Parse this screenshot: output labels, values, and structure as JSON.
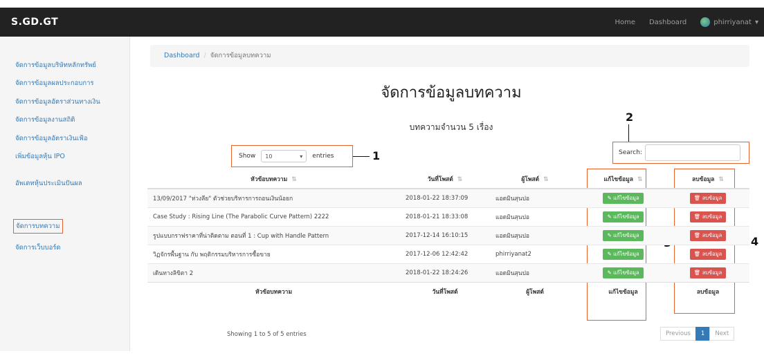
{
  "navbar": {
    "brand": "S.GD.GT",
    "home": "Home",
    "dashboard": "Dashboard",
    "user": "phirriyanat"
  },
  "sidebar": {
    "items": [
      {
        "label": "จัดการข้อมูลบริษัทหลักทรัพย์"
      },
      {
        "label": "จัดการข้อมูลผลประกอบการ"
      },
      {
        "label": "จัดการข้อมูลอัตราส่วนทางเงิน"
      },
      {
        "label": "จัดการข้อมูลงานสถิติ"
      },
      {
        "label": "จัดการข้อมูลอัตราเงินเฟ้อ"
      },
      {
        "label": "เพิ่มข้อมูลหุ้น IPO"
      },
      {
        "label": "อัพเดทหุ้นประเมินปันผล"
      },
      {
        "label": "จัดการบทความ"
      },
      {
        "label": "จัดการเว็บบอร์ด"
      }
    ]
  },
  "breadcrumb": {
    "home": "Dashboard",
    "current": "จัดการข้อมูลบทความ"
  },
  "page_title": "จัดการข้อมูลบทความ",
  "count_text": "บทความจำนวน 5 เรื่อง",
  "table_length": {
    "show": "Show",
    "value": "10",
    "entries": "entries"
  },
  "search": {
    "label": "Search:",
    "value": ""
  },
  "callouts": [
    "1",
    "2",
    "3",
    "4"
  ],
  "table": {
    "headers": [
      "หัวข้อบทความ",
      "วันที่โพสต์",
      "ผู้โพสต์",
      "แก้ไขข้อมูล",
      "ลบข้อมูล"
    ],
    "edit_label": "แก้ไขข้อมูล",
    "delete_label": "ลบข้อมูล",
    "rows": [
      {
        "title": "13/09/2017 \"ห่วงลีย\" ตัวช่วยบริหารการถอนเงินน้อยก",
        "date": "2018-01-22 18:37:09",
        "author": "แอดมินสุนปอ"
      },
      {
        "title": "Case Study : Rising Line (The Parabolic Curve Pattern) 2222",
        "date": "2018-01-21 18:33:08",
        "author": "แอดมินสุนปอ"
      },
      {
        "title": "รูปแบบกราฟราคาที่น่าติดตาม ตอนที่ 1 : Cup with Handle Pattern",
        "date": "2017-12-14 16:10:15",
        "author": "แอดมินสุนปอ"
      },
      {
        "title": "วิฏจักรพื้นฐาน กับ พฤติกรรมบริหารการซื้อขาย",
        "date": "2017-12-06 12:42:42",
        "author": "phirriyanat2"
      },
      {
        "title": "เดินทางลิขิตา 2",
        "date": "2018-01-22 18:24:26",
        "author": "แอดมินสุนปอ"
      }
    ]
  },
  "info": "Showing 1 to 5 of 5 entries",
  "pagination": {
    "previous": "Previous",
    "page": "1",
    "next": "Next"
  }
}
